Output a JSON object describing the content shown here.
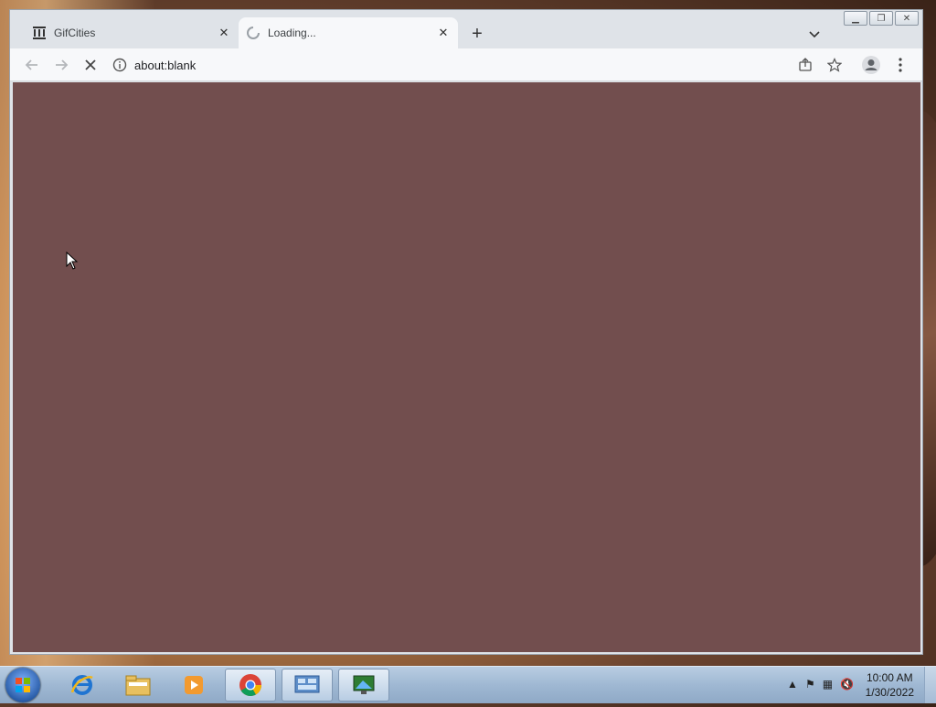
{
  "browser": {
    "tabs": [
      {
        "title": "GifCities",
        "favicon": "archive-icon",
        "active": false
      },
      {
        "title": "Loading...",
        "favicon": "loading-spinner-icon",
        "active": true
      }
    ],
    "address": "about:blank",
    "content_background": "#724e4e"
  },
  "window_controls": [
    "minimize-icon",
    "restore-icon",
    "close-icon"
  ],
  "taskbar": {
    "apps": [
      "internet-explorer-icon",
      "file-explorer-icon",
      "media-player-icon",
      "chrome-icon",
      "control-panel-icon",
      "remote-desktop-icon"
    ],
    "active_app": "chrome-icon",
    "clock": {
      "time": "10:00 AM",
      "date": "1/30/2022"
    }
  }
}
